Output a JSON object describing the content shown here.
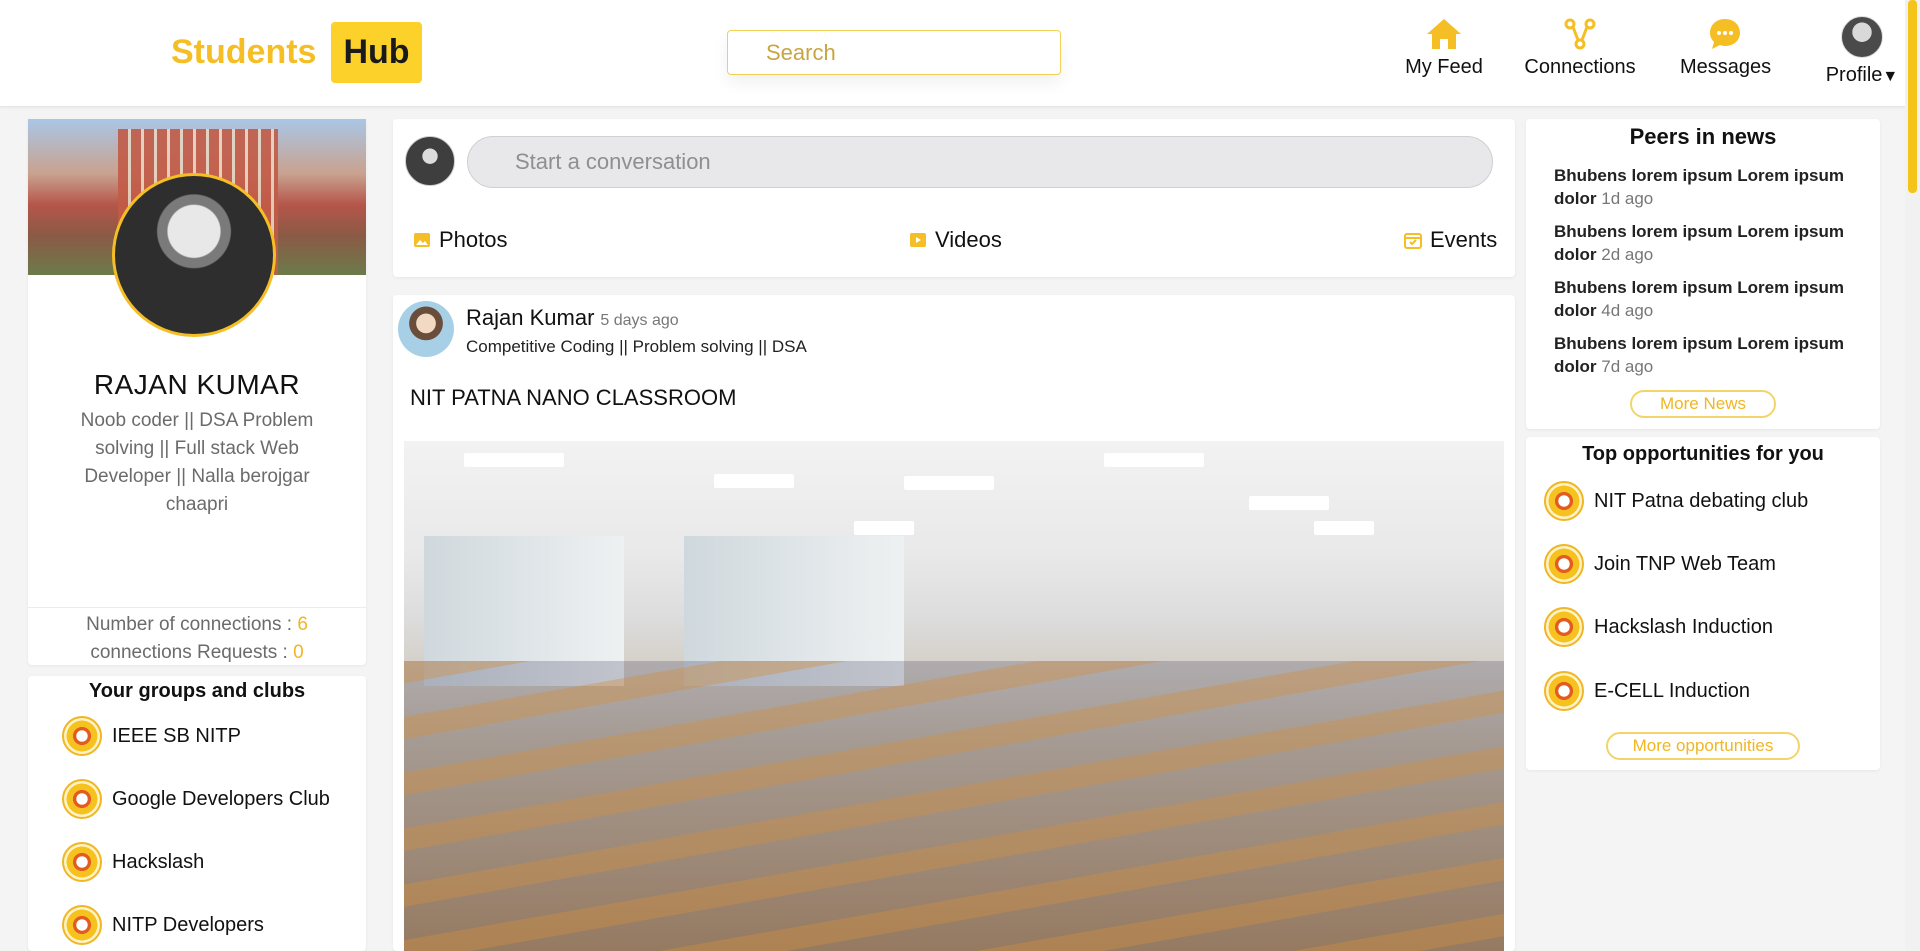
{
  "brand": {
    "left": "Students",
    "right": "Hub"
  },
  "search": {
    "placeholder": "Search"
  },
  "nav": {
    "feed": "My Feed",
    "connections": "Connections",
    "messages": "Messages",
    "profile": "Profile"
  },
  "colors": {
    "accent": "#f5be24",
    "accent_box": "#fcd12a",
    "muted": "#6b6b6b"
  },
  "profile": {
    "name": "RAJAN KUMAR",
    "bio": "Noob coder || DSA Problem solving || Full stack Web Developer || Nalla berojgar chaapri",
    "connections_label": "Number of connections :",
    "connections_value": "6",
    "requests_label": "connections Requests :",
    "requests_value": "0"
  },
  "groups": {
    "title": "Your groups and clubs",
    "items": [
      "IEEE SB NITP",
      "Google Developers Club",
      "Hackslash",
      "NITP Developers"
    ]
  },
  "composer": {
    "placeholder": "Start a conversation",
    "photos": "Photos",
    "videos": "Videos",
    "events": "Events"
  },
  "post": {
    "author": "Rajan Kumar",
    "time": "5 days ago",
    "subtitle": "Competitive Coding || Problem solving || DSA",
    "title": "NIT PATNA NANO CLASSROOM"
  },
  "news": {
    "title": "Peers in news",
    "items": [
      {
        "text": "Bhubens lorem ipsum Lorem ipsum dolor",
        "ago": "1d ago"
      },
      {
        "text": "Bhubens lorem ipsum Lorem ipsum dolor",
        "ago": "2d ago"
      },
      {
        "text": "Bhubens lorem ipsum Lorem ipsum dolor",
        "ago": "4d ago"
      },
      {
        "text": "Bhubens lorem ipsum Lorem ipsum dolor",
        "ago": "7d ago"
      }
    ],
    "more": "More News"
  },
  "opportunities": {
    "title": "Top opportunities for you",
    "items": [
      "NIT Patna debating club",
      "Join TNP Web Team",
      "Hackslash Induction",
      "E-CELL Induction"
    ],
    "more": "More opportunities"
  }
}
